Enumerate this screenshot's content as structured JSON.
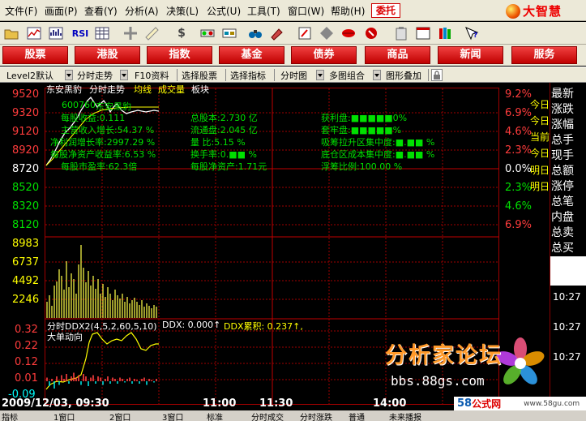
{
  "menubar": {
    "items": [
      "文件(F)",
      "画面(P)",
      "查看(Y)",
      "分析(A)",
      "决策(L)",
      "公式(U)",
      "工具(T)",
      "窗口(W)",
      "帮助(H)"
    ],
    "entrust": "委托",
    "logo": "大智慧"
  },
  "toolbar": {
    "rsi_label": "RSI",
    "dollar_label": "$"
  },
  "navbar": {
    "tabs": [
      "股票",
      "港股",
      "指数",
      "基金",
      "债券",
      "商品",
      "新闻",
      "服务"
    ]
  },
  "funcbar": {
    "level2": "Level2默认",
    "trend": "分时走势",
    "f10": "F10资料",
    "select_stock": "选择股票",
    "select_indicator": "选择指标",
    "tick_chart": "分时图",
    "multi": "多图组合",
    "overlay": "图形叠加"
  },
  "chart": {
    "header": {
      "stock": "东安黑豹",
      "mode": "分时走势",
      "avg": "均线",
      "vol": "成交量",
      "sector": "板块"
    },
    "y_left": [
      "9520",
      "9320",
      "9120",
      "8920",
      "8720",
      "8520",
      "8320",
      "8120"
    ],
    "y_right": [
      "9.2%",
      "6.9%",
      "4.6%",
      "2.3%",
      "0.0%",
      "2.3%",
      "4.6%",
      "6.9%"
    ],
    "vol_axis": [
      "8983",
      "6737",
      "4492",
      "2246"
    ],
    "ddx_axis": [
      "0.32",
      "0.22",
      "0.12",
      "0.01",
      "-0.09"
    ],
    "x_axis": {
      "date": "2009/12/03, 09:30",
      "t1": "11:00",
      "t2": "11:30",
      "t3": "14:00"
    },
    "info": {
      "code": "600760",
      "name": "东安黑豹",
      "eps": "每股收益:0.111",
      "rev_growth": "主营收入增长:54.37 %",
      "profit_growth": "净利润增长率:2997.29 %",
      "bvps": "每股净资产收益率:6.53 %",
      "pe": "每股市盈率:62.3倍",
      "total_shares": "总股本:2.730 亿",
      "float_shares": "流通盘:2.045 亿",
      "vol_ratio": "量  比:5.15 %",
      "turnover": "换手率:0.■■ %",
      "nav": "每股净资产:1.71元",
      "profit_plate": "获利盘:■■■■■0%",
      "trapped_plate": "套牢盘:■■■■■%",
      "pull_conc": "吸筹拉升区集中度:■.■■ %",
      "cost_conc": "底仓区成本集中度:■.■■ %",
      "float_ratio": "浮筹比例:100.00 %"
    },
    "ddx_title": "分时DDX2(4,5,2,60,5,10)",
    "ddx_value": "DDX: 0.000↑",
    "ddx_cum": "DDX累积: 0.237↑,",
    "ddx_sub": "大单动向"
  },
  "right_panel": {
    "items": [
      "最新",
      "涨跌",
      "涨幅",
      "总手",
      "现手",
      "总额",
      "涨停",
      "总笔",
      "内盘",
      "总卖",
      "总买"
    ],
    "times": [
      "10:27",
      "10:27",
      "10:27"
    ],
    "overlay": [
      "今日",
      "今日",
      "当前",
      "今日",
      "明日",
      "明日"
    ]
  },
  "bottombar": {
    "tabs": [
      "指标",
      "1窗口",
      "2窗口",
      "3窗口",
      "标准",
      "分时成交",
      "分时涨跌",
      "普通",
      "未来播报"
    ]
  },
  "watermark": {
    "text": "分析家论坛",
    "url": "bbs.88gs.com",
    "site2_a": "58",
    "site2_b": "公式网",
    "site2_url": "www.58gu.com"
  }
}
